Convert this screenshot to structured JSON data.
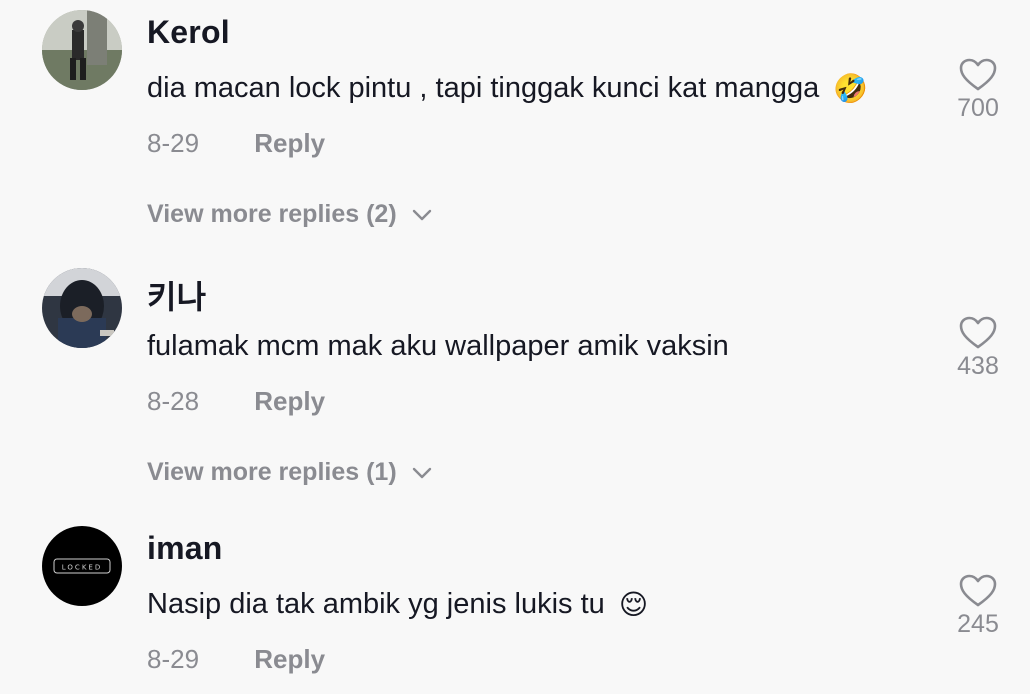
{
  "comments": [
    {
      "username": "Kerol",
      "text": "dia macan lock pintu , tapi tinggak kunci kat mangga",
      "emoji": "🤣",
      "date": "8-29",
      "reply_label": "Reply",
      "likes": "700",
      "view_more": "View more replies (2)"
    },
    {
      "username": "키나",
      "text": "fulamak mcm mak aku wallpaper amik vaksin",
      "emoji": "",
      "date": "8-28",
      "reply_label": "Reply",
      "likes": "438",
      "view_more": "View more replies (1)"
    },
    {
      "username": "iman",
      "text": "Nasip dia tak ambik yg jenis lukis tu",
      "emoji": "😌",
      "date": "8-29",
      "reply_label": "Reply",
      "likes": "245",
      "avatar_text": "LOCKED"
    }
  ],
  "colors": {
    "background": "#f8f8f8",
    "primary_text": "#161823",
    "secondary_text": "#8a8b91"
  },
  "icons": {
    "like": "heart-outline-icon",
    "expand": "chevron-down-icon"
  }
}
